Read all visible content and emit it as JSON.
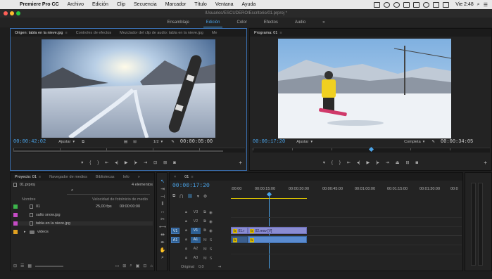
{
  "menubar": {
    "app_name": "Premiere Pro CC",
    "items": [
      "Archivo",
      "Edición",
      "Clip",
      "Secuencia",
      "Marcador",
      "Título",
      "Ventana",
      "Ayuda"
    ],
    "clock": "Vie 2:48"
  },
  "window": {
    "title": "/Usuarios/ESCUDERO/Escritorio/01.prproj *"
  },
  "workspaces": {
    "items": [
      "Ensamblaje",
      "Edición",
      "Color",
      "Efectos",
      "Audio"
    ],
    "active": "Edición",
    "more": "»"
  },
  "source_monitor": {
    "tabs": [
      "Origen: tabla en la nieve.jpg",
      "Controles de efectos",
      "Mezclador del clip de audio: tabla en la nieve.jpg",
      "Me"
    ],
    "timecode": "00:00:42:02",
    "fit": "Ajustar",
    "resolution": "1/2",
    "duration": "00:00:05:00"
  },
  "program_monitor": {
    "tab": "Programa: 01",
    "timecode": "00:00:17:20",
    "fit": "Ajustar",
    "resolution": "Completa",
    "duration": "00:00:34:05"
  },
  "project": {
    "tabs": [
      "Proyecto: 01",
      "Navegador de medios",
      "Bibliotecas",
      "Info",
      "»"
    ],
    "file": "01.prproj",
    "count": "4 elementos",
    "columns": {
      "name": "Nombre",
      "fps": "Velocidad de foto",
      "start": "Inicio de medio"
    },
    "items": [
      {
        "name": "01",
        "fps": "25,00 fps",
        "start": "00:00:00:00",
        "color": "#3cb44b",
        "kind": "sequence"
      },
      {
        "name": "salto snow.jpg",
        "fps": "",
        "start": "",
        "color": "#c54cc5",
        "kind": "file"
      },
      {
        "name": "tabla en la nieve.jpg",
        "fps": "",
        "start": "",
        "color": "#c54cc5",
        "kind": "file"
      },
      {
        "name": "videos",
        "fps": "",
        "start": "",
        "color": "#e0a020",
        "kind": "folder"
      }
    ]
  },
  "timeline": {
    "tab": "01",
    "timecode": "00:00:17:20",
    "ruler": [
      ":00:00",
      "00:00:15:00",
      "00:00:30:00",
      "00:00:45:00",
      "00:01:00:00",
      "00:01:15:00",
      "00:01:30:00",
      "00:0"
    ],
    "tracks": [
      {
        "name": "V3",
        "src": "",
        "type": "video"
      },
      {
        "name": "V2",
        "src": "",
        "type": "video"
      },
      {
        "name": "V1",
        "src": "V1",
        "type": "video"
      },
      {
        "name": "A1",
        "src": "A1",
        "type": "audio"
      },
      {
        "name": "A2",
        "src": "",
        "type": "audio"
      },
      {
        "name": "A3",
        "src": "",
        "type": "audio"
      }
    ],
    "master": {
      "label": "Original",
      "value": "0,0"
    },
    "clips": {
      "v1a": "01.r",
      "v1b": "02.mov [V]"
    }
  },
  "colors": {
    "accent": "#4aa3e8",
    "clip_video": "#8a8cd2",
    "clip_audio": "#5a8bd0"
  }
}
